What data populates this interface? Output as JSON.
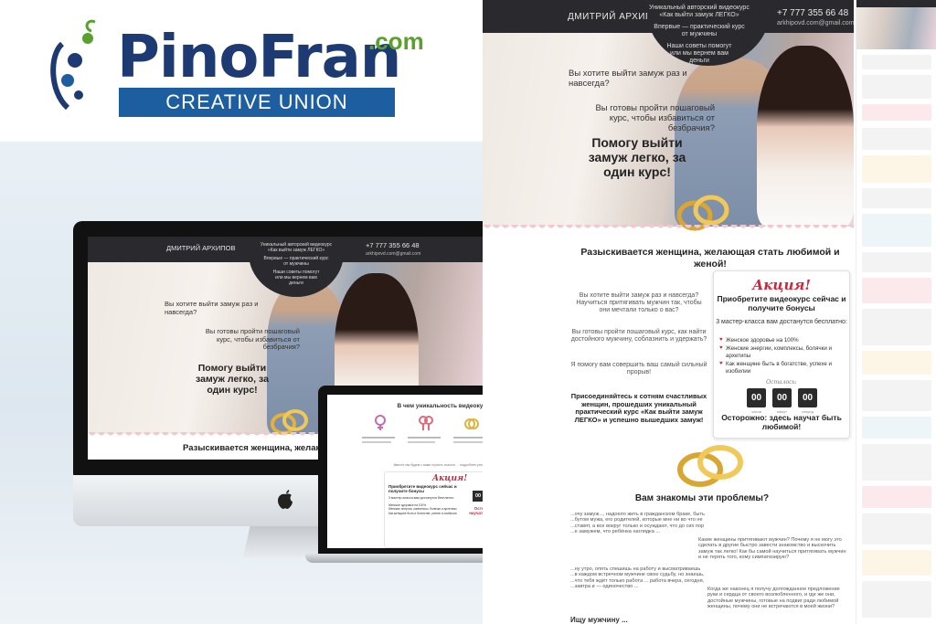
{
  "brand": {
    "logo_word": "PinoFran",
    "logo_com": ".com",
    "tagline": "CREATIVE UNION",
    "colors": {
      "navy": "#1d3a73",
      "green": "#5aa02c",
      "bar": "#1d5ea0",
      "accent_red": "#d2253c"
    }
  },
  "landing": {
    "header": {
      "author": "ДМИТРИЙ АРХИПОВ",
      "phone": "+7 777 355 66 48",
      "email": "arkhipovd.com@gmail.com",
      "circle_lines": [
        "Уникальный авторский видеокурс",
        "«Как выйти замуж ЛЕГКО»",
        "Впервые — практический курс",
        "от мужчины",
        "Наши советы помогут",
        "или мы вернем вам",
        "деньги"
      ]
    },
    "hero": {
      "q1": "Вы хотите выйти замуж раз и навсегда?",
      "q2": "Вы готовы пройти пошаговый курс, чтобы избавиться от безбрачия?",
      "headline": "Помогу выйти замуж легко, за один курс!"
    },
    "section_title": "Разыскивается женщина, желающая стать любимой и женой!",
    "section_title_short": "Разыскивается женщина, желающ",
    "body": {
      "p1": "Вы хотите выйти замуж раз и навсегда? Научиться притягивать мужчин так, чтобы они мечтали только о вас?",
      "p2": "Вы готовы пройти пошаговый курс, как найти достойного мужчину, соблазнить и удержать?",
      "p3": "Я помогу вам совершить ваш самый сильный прорыв!",
      "p4": "Присоединяйтесь к сотням счастливых женщин, прошедших уникальный практический курс «Как выйти замуж ЛЕГКО» и успешно вышедших замуж!"
    },
    "promo": {
      "title": "Акция!",
      "subtitle": "Приобретите видеокурс сейчас и получите бонусы",
      "line": "3 мастер-класса вам достанутся бесплатно:",
      "items": [
        "Женское здоровье на 100%",
        "Женские энергии, комплексы, болячки и архетипы",
        "Как женщине быть в богатстве, успехе и изобилии"
      ],
      "left_label": "Осталось:",
      "counters": [
        "00",
        "00",
        "00"
      ],
      "counter_labels": [
        "часов",
        "минут",
        "секунд"
      ],
      "warning": "Осторожно: здесь научат быть любимой!"
    },
    "problems_title": "Вам знакомы эти проблемы?",
    "problems": {
      "a": "...очу замуж..., надоело жить в гражданском браке, быть ...бутом мужа, его родителей, которые мне ни во что не ...ставят, а все вокруг только и осуждают, что до сих пор ...е замужем, что ребёнка наглядка ...",
      "b": "Какие женщины притягивают мужчин? Почему я не могу это сделать в другие быстро завести знакомство и выскочить замуж так легко! Как бы самой научиться притягивать мужчин и не терять того, кому симпатизирую?",
      "c": "...ну утро, опять спешишь на работу и высматриваешь ...в каждом встречном мужчине свою судьбу, но знаешь, ...что тебя ждёт только работа ... работа вчера, сегодня, ...завтра и — одиночество ...",
      "d": "Когда же наконец я получу долгожданное предложение руки и сердца от своего возлюбленного, и где же они, достойные мужчины, готовые на подвиг ради любимой женщины, почему они не встречаются в моей жизни?"
    },
    "bottom_cut": "Ищу мужчину ..."
  },
  "laptop": {
    "section_title": "В чем уникальность видеокурса",
    "note": "Вместе мы будем с вами строить счастье ... подробнее узнаете ниже"
  }
}
